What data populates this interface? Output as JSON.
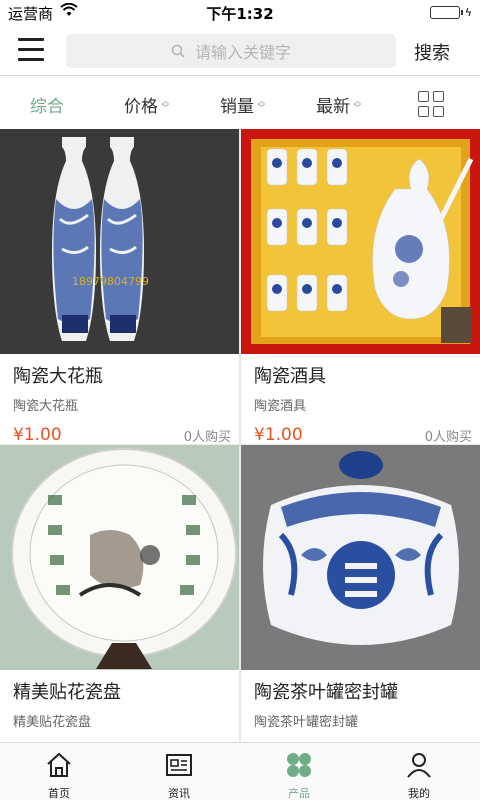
{
  "status_bar": {
    "carrier": "运营商",
    "time": "下午1:32"
  },
  "header": {
    "search_placeholder": "请输入关键字",
    "search_button": "搜索"
  },
  "filters": [
    {
      "label": "综合",
      "active": true
    },
    {
      "label": "价格",
      "active": false
    },
    {
      "label": "销量",
      "active": false
    },
    {
      "label": "最新",
      "active": false
    }
  ],
  "products": [
    {
      "name": "陶瓷大花瓶",
      "subtitle": "陶瓷大花瓶",
      "price": "¥1.00",
      "sold": "0人购买",
      "image_watermark": "18979804799"
    },
    {
      "name": "陶瓷酒具",
      "subtitle": "陶瓷酒具",
      "price": "¥1.00",
      "sold": "0人购买",
      "image_watermark": ""
    },
    {
      "name": "精美贴花瓷盘",
      "subtitle": "精美贴花瓷盘",
      "price": "",
      "sold": "",
      "image_watermark": ""
    },
    {
      "name": "陶瓷茶叶罐密封罐",
      "subtitle": "陶瓷茶叶罐密封罐",
      "price": "",
      "sold": "",
      "image_watermark": ""
    }
  ],
  "tabbar": [
    {
      "label": "首页",
      "icon": "home-icon",
      "active": false
    },
    {
      "label": "资讯",
      "icon": "news-icon",
      "active": false
    },
    {
      "label": "产品",
      "icon": "product-icon",
      "active": true
    },
    {
      "label": "我的",
      "icon": "user-icon",
      "active": false
    }
  ],
  "colors": {
    "accent": "#6fae85",
    "price": "#e8531d"
  }
}
